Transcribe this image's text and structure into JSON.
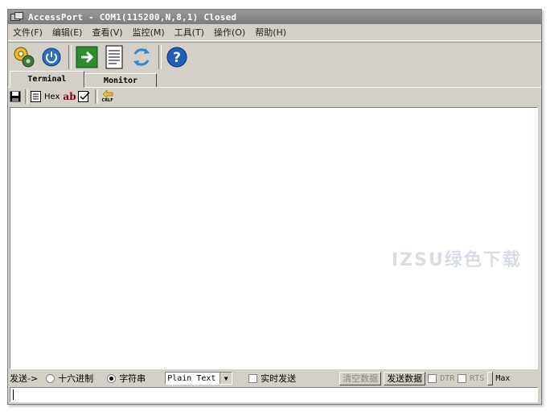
{
  "window": {
    "title": "AccessPort - COM1(115200,N,8,1) Closed"
  },
  "menu": [
    {
      "label": "文件(F)"
    },
    {
      "label": "编辑(E)"
    },
    {
      "label": "查看(V)"
    },
    {
      "label": "监控(M)"
    },
    {
      "label": "工具(T)"
    },
    {
      "label": "操作(O)"
    },
    {
      "label": "帮助(H)"
    }
  ],
  "tabs": {
    "terminal": "Terminal",
    "monitor": "Monitor"
  },
  "subtoolbar": {
    "hex": "Hex",
    "ab": "ab",
    "crlf": "CRLF"
  },
  "sendbar": {
    "send_label": "发送->",
    "hex_option": "十六进制",
    "string_option": "字符串",
    "format_value": "Plain Text",
    "realtime_label": "实时发送",
    "clear_button": "清空数据",
    "send_button": "发送数据",
    "dtr": "DTR",
    "rts": "RTS",
    "max": "Max"
  },
  "watermark": "IZSU绿色下载",
  "colors": {
    "accent_green": "#2e8b2e",
    "help_blue": "#1f5fbf"
  }
}
